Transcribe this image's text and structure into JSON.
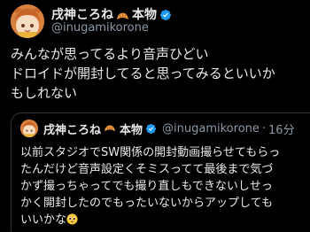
{
  "tweet": {
    "display_name": "戌神ころね",
    "name_suffix": "本物",
    "handle": "@inugamikorone",
    "body_lines": [
      "みんなが思ってるより音声ひどい",
      "ドロイドが開封してると思ってみるといいか",
      "もしれない"
    ]
  },
  "quote": {
    "display_name": "戌神ころね",
    "name_suffix": "本物",
    "handle": "@inugamikorone",
    "separator": "·",
    "time": "16分",
    "body_lines": [
      "以前スタジオでSW関係の開封動画撮らせてもらっ",
      "たんだけど音声設定くそミスってて最後まで気づ",
      "かず撮っちゃってでも撮り直しもできないしせっ",
      "かく開封したのでもったいないからアップしても",
      "いいかな"
    ]
  },
  "icons": {
    "croissant": "croissant-emoji-icon",
    "verified": "verified-badge-icon",
    "pleading": "pleading-face-emoji-icon",
    "avatar": "dog-girl-avatar"
  },
  "colors": {
    "background": "#000000",
    "text": "#e7e9ea",
    "secondary": "#8b98a5",
    "verified": "#1d9bf0",
    "border": "#2f3336"
  }
}
